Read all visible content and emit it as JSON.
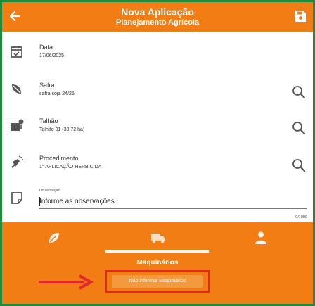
{
  "header": {
    "title": "Nova Aplicação",
    "subtitle": "Planejamento Agrícola",
    "back_icon": "arrow-left-icon",
    "save_icon": "floppy-disk-icon"
  },
  "fields": [
    {
      "label": "Data",
      "value": "17/06/2025",
      "icon": "calendar-check-icon"
    },
    {
      "label": "Safra",
      "value": "safra soja 24/25",
      "icon": "sprout-leaf-icon"
    },
    {
      "label": "Talhão",
      "value": "Talhão 01 (33,72 ha)",
      "icon": "field-plots-icon"
    },
    {
      "label": "Procedimento",
      "value": "1° APLICAÇÃO HERBICIDA",
      "icon": "sprayer-icon"
    }
  ],
  "observacao": {
    "label": "Observação",
    "placeholder": "Informe as observações",
    "value": "",
    "counter": "0/1000",
    "icon": "note-icon"
  },
  "bottom": {
    "tabs": [
      {
        "icon": "leaf-icon",
        "selected": false
      },
      {
        "icon": "truck-icon",
        "selected": true
      },
      {
        "icon": "person-icon",
        "selected": false
      }
    ],
    "section_label": "Maquinários",
    "skip_button_label": "Não informar Maquinários"
  },
  "colors": {
    "primary": "#f17d14",
    "frame": "#1e8a3c",
    "highlight": "#e6262a"
  }
}
